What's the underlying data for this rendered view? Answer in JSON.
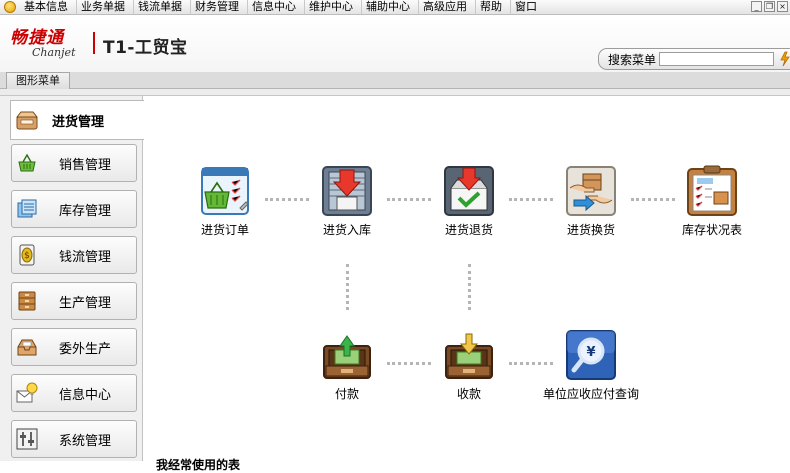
{
  "menubar": {
    "items": [
      "基本信息",
      "业务单据",
      "钱流单据",
      "财务管理",
      "信息中心",
      "维护中心",
      "辅助中心",
      "高级应用",
      "帮助",
      "窗口"
    ]
  },
  "header": {
    "logo_cn": "畅捷通",
    "logo_en": "Chanjet",
    "product_name": "T1-工贸宝",
    "search_label": "搜索菜单",
    "search_value": ""
  },
  "tabs": {
    "active": "图形菜单"
  },
  "sidebar": {
    "header_label": "进货管理",
    "items": [
      {
        "label": "销售管理",
        "icon": "basket-icon"
      },
      {
        "label": "库存管理",
        "icon": "inventory-icon"
      },
      {
        "label": "钱流管理",
        "icon": "coin-icon"
      },
      {
        "label": "生产管理",
        "icon": "cabinet-icon"
      },
      {
        "label": "委外生产",
        "icon": "tray-icon"
      },
      {
        "label": "信息中心",
        "icon": "mail-bulb-icon"
      },
      {
        "label": "系统管理",
        "icon": "settings-icon"
      }
    ]
  },
  "workflow": {
    "purchase_order": "进货订单",
    "purchase_in": "进货入库",
    "purchase_return": "进货退货",
    "purchase_exchange": "进货换货",
    "inventory_report": "库存状况表",
    "payment": "付款",
    "receipt": "收款",
    "payable_query": "单位应收应付查询"
  },
  "footer": {
    "text": "我经常使用的表"
  },
  "colors": {
    "brand_red": "#cc0000",
    "icon_brown": "#8b5a2b",
    "dots": "#b5b5b5"
  }
}
